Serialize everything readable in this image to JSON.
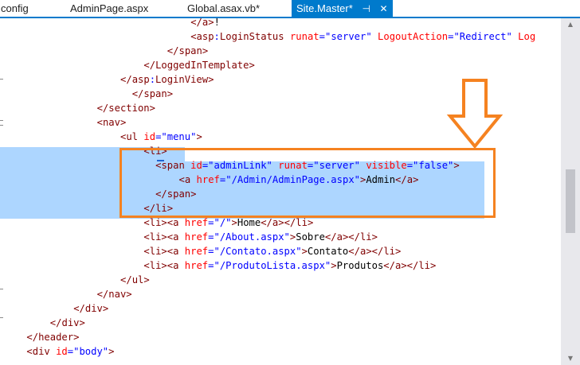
{
  "tabs": [
    {
      "label": "config"
    },
    {
      "label": "AdminPage.aspx"
    },
    {
      "label": "Global.asax.vb*"
    },
    {
      "label": "Site.Master*",
      "pin": "⊣",
      "close": "✕"
    }
  ],
  "code_lines": [
    {
      "indent": 32,
      "tokens": [
        [
          "tg",
          "</"
        ],
        [
          "tg",
          "a"
        ],
        [
          "tg",
          ">"
        ],
        [
          "tx",
          "!"
        ]
      ]
    },
    {
      "indent": 32,
      "tokens": [
        [
          "tg",
          "<"
        ],
        [
          "tg",
          "asp"
        ],
        [
          "dl",
          ":"
        ],
        [
          "tg",
          "LoginStatus"
        ],
        [
          "tx",
          " "
        ],
        [
          "at",
          "runat"
        ],
        [
          "dl",
          "="
        ],
        [
          "av",
          "\"server\""
        ],
        [
          "tx",
          " "
        ],
        [
          "at",
          "LogoutAction"
        ],
        [
          "dl",
          "="
        ],
        [
          "av",
          "\"Redirect\""
        ],
        [
          "tx",
          " "
        ],
        [
          "at",
          "Log"
        ]
      ]
    },
    {
      "indent": 28,
      "tokens": [
        [
          "tg",
          "</"
        ],
        [
          "tg",
          "span"
        ],
        [
          "tg",
          ">"
        ]
      ]
    },
    {
      "indent": 24,
      "tokens": [
        [
          "tg",
          "</"
        ],
        [
          "tg",
          "LoggedInTemplate"
        ],
        [
          "tg",
          ">"
        ]
      ]
    },
    {
      "indent": 20,
      "tokens": [
        [
          "tg",
          "</"
        ],
        [
          "tg",
          "asp"
        ],
        [
          "dl",
          ":"
        ],
        [
          "tg",
          "LoginView"
        ],
        [
          "tg",
          ">"
        ]
      ]
    },
    {
      "indent": 20,
      "tokens": [
        [
          "tx",
          "  "
        ],
        [
          "tg",
          "</"
        ],
        [
          "tg",
          "span"
        ],
        [
          "tg",
          ">"
        ]
      ]
    },
    {
      "indent": 16,
      "tokens": [
        [
          "tg",
          "</"
        ],
        [
          "tg",
          "section"
        ],
        [
          "tg",
          ">"
        ]
      ]
    },
    {
      "indent": 16,
      "tokens": [
        [
          "tg",
          "<"
        ],
        [
          "tg",
          "nav"
        ],
        [
          "tg",
          ">"
        ]
      ]
    },
    {
      "indent": 20,
      "tokens": [
        [
          "tg",
          "<"
        ],
        [
          "tg",
          "ul"
        ],
        [
          "tx",
          " "
        ],
        [
          "at",
          "id"
        ],
        [
          "dl",
          "="
        ],
        [
          "av",
          "\"menu\""
        ],
        [
          "tg",
          ">"
        ]
      ]
    },
    {
      "indent": 24,
      "tokens": [
        [
          "tg",
          "<"
        ],
        [
          "tg",
          "li"
        ],
        [
          "tg",
          ">"
        ]
      ]
    },
    {
      "indent": 26,
      "tokens": [
        [
          "tg",
          "<"
        ],
        [
          "tg",
          "span"
        ],
        [
          "tx",
          " "
        ],
        [
          "at",
          "id"
        ],
        [
          "dl",
          "="
        ],
        [
          "av",
          "\"adminLink\""
        ],
        [
          "tx",
          " "
        ],
        [
          "at",
          "runat"
        ],
        [
          "dl",
          "="
        ],
        [
          "av",
          "\"server\""
        ],
        [
          "tx",
          " "
        ],
        [
          "at",
          "visible"
        ],
        [
          "dl",
          "="
        ],
        [
          "av",
          "\"false\""
        ],
        [
          "tg",
          ">"
        ]
      ]
    },
    {
      "indent": 30,
      "tokens": [
        [
          "tg",
          "<"
        ],
        [
          "tg",
          "a"
        ],
        [
          "tx",
          " "
        ],
        [
          "at",
          "href"
        ],
        [
          "dl",
          "="
        ],
        [
          "av",
          "\"/Admin/AdminPage.aspx\""
        ],
        [
          "tg",
          ">"
        ],
        [
          "tx",
          "Admin"
        ],
        [
          "tg",
          "</"
        ],
        [
          "tg",
          "a"
        ],
        [
          "tg",
          ">"
        ]
      ]
    },
    {
      "indent": 26,
      "tokens": [
        [
          "tg",
          "</"
        ],
        [
          "tg",
          "span"
        ],
        [
          "tg",
          ">"
        ]
      ]
    },
    {
      "indent": 24,
      "tokens": [
        [
          "tg",
          "</"
        ],
        [
          "tg",
          "li"
        ],
        [
          "tg",
          ">"
        ]
      ]
    },
    {
      "indent": 24,
      "tokens": [
        [
          "tg",
          "<"
        ],
        [
          "tg",
          "li"
        ],
        [
          "tg",
          "><"
        ],
        [
          "tg",
          "a"
        ],
        [
          "tx",
          " "
        ],
        [
          "at",
          "href"
        ],
        [
          "dl",
          "="
        ],
        [
          "av",
          "\"/\""
        ],
        [
          "tg",
          ">"
        ],
        [
          "tx",
          "Home"
        ],
        [
          "tg",
          "</"
        ],
        [
          "tg",
          "a"
        ],
        [
          "tg",
          "></"
        ],
        [
          "tg",
          "li"
        ],
        [
          "tg",
          ">"
        ]
      ]
    },
    {
      "indent": 24,
      "tokens": [
        [
          "tg",
          "<"
        ],
        [
          "tg",
          "li"
        ],
        [
          "tg",
          "><"
        ],
        [
          "tg",
          "a"
        ],
        [
          "tx",
          " "
        ],
        [
          "at",
          "href"
        ],
        [
          "dl",
          "="
        ],
        [
          "av",
          "\"/About.aspx\""
        ],
        [
          "tg",
          ">"
        ],
        [
          "tx",
          "Sobre"
        ],
        [
          "tg",
          "</"
        ],
        [
          "tg",
          "a"
        ],
        [
          "tg",
          "></"
        ],
        [
          "tg",
          "li"
        ],
        [
          "tg",
          ">"
        ]
      ]
    },
    {
      "indent": 24,
      "tokens": [
        [
          "tg",
          "<"
        ],
        [
          "tg",
          "li"
        ],
        [
          "tg",
          "><"
        ],
        [
          "tg",
          "a"
        ],
        [
          "tx",
          " "
        ],
        [
          "at",
          "href"
        ],
        [
          "dl",
          "="
        ],
        [
          "av",
          "\"/Contato.aspx\""
        ],
        [
          "tg",
          ">"
        ],
        [
          "tx",
          "Contato"
        ],
        [
          "tg",
          "</"
        ],
        [
          "tg",
          "a"
        ],
        [
          "tg",
          "></"
        ],
        [
          "tg",
          "li"
        ],
        [
          "tg",
          ">"
        ]
      ]
    },
    {
      "indent": 24,
      "tokens": [
        [
          "tg",
          "<"
        ],
        [
          "tg",
          "li"
        ],
        [
          "tg",
          "><"
        ],
        [
          "tg",
          "a"
        ],
        [
          "tx",
          " "
        ],
        [
          "at",
          "href"
        ],
        [
          "dl",
          "="
        ],
        [
          "av",
          "\"/ProdutoLista.aspx\""
        ],
        [
          "tg",
          ">"
        ],
        [
          "tx",
          "Produtos"
        ],
        [
          "tg",
          "</"
        ],
        [
          "tg",
          "a"
        ],
        [
          "tg",
          "></"
        ],
        [
          "tg",
          "li"
        ],
        [
          "tg",
          ">"
        ]
      ]
    },
    {
      "indent": 20,
      "tokens": [
        [
          "tg",
          "</"
        ],
        [
          "tg",
          "ul"
        ],
        [
          "tg",
          ">"
        ]
      ]
    },
    {
      "indent": 16,
      "tokens": [
        [
          "tg",
          "</"
        ],
        [
          "tg",
          "nav"
        ],
        [
          "tg",
          ">"
        ]
      ]
    },
    {
      "indent": 12,
      "tokens": [
        [
          "tg",
          "</"
        ],
        [
          "tg",
          "div"
        ],
        [
          "tg",
          ">"
        ]
      ]
    },
    {
      "indent": 8,
      "tokens": [
        [
          "tg",
          "</"
        ],
        [
          "tg",
          "div"
        ],
        [
          "tg",
          ">"
        ]
      ]
    },
    {
      "indent": 4,
      "tokens": [
        [
          "tg",
          "</"
        ],
        [
          "tg",
          "header"
        ],
        [
          "tg",
          ">"
        ]
      ]
    },
    {
      "indent": 4,
      "tokens": [
        [
          "tg",
          "<"
        ],
        [
          "tg",
          "div"
        ],
        [
          "tx",
          " "
        ],
        [
          "at",
          "id"
        ],
        [
          "dl",
          "="
        ],
        [
          "av",
          "\"body\""
        ],
        [
          "tg",
          ">"
        ]
      ]
    }
  ],
  "colors": {
    "tag": "#800000",
    "attribute": "#ff0000",
    "value": "#0000ff",
    "text": "#000000",
    "selection": "#add6ff",
    "highlight_box": "#f58220",
    "tab_active": "#007acc"
  },
  "icons": {
    "arrow": "down-arrow-icon"
  }
}
